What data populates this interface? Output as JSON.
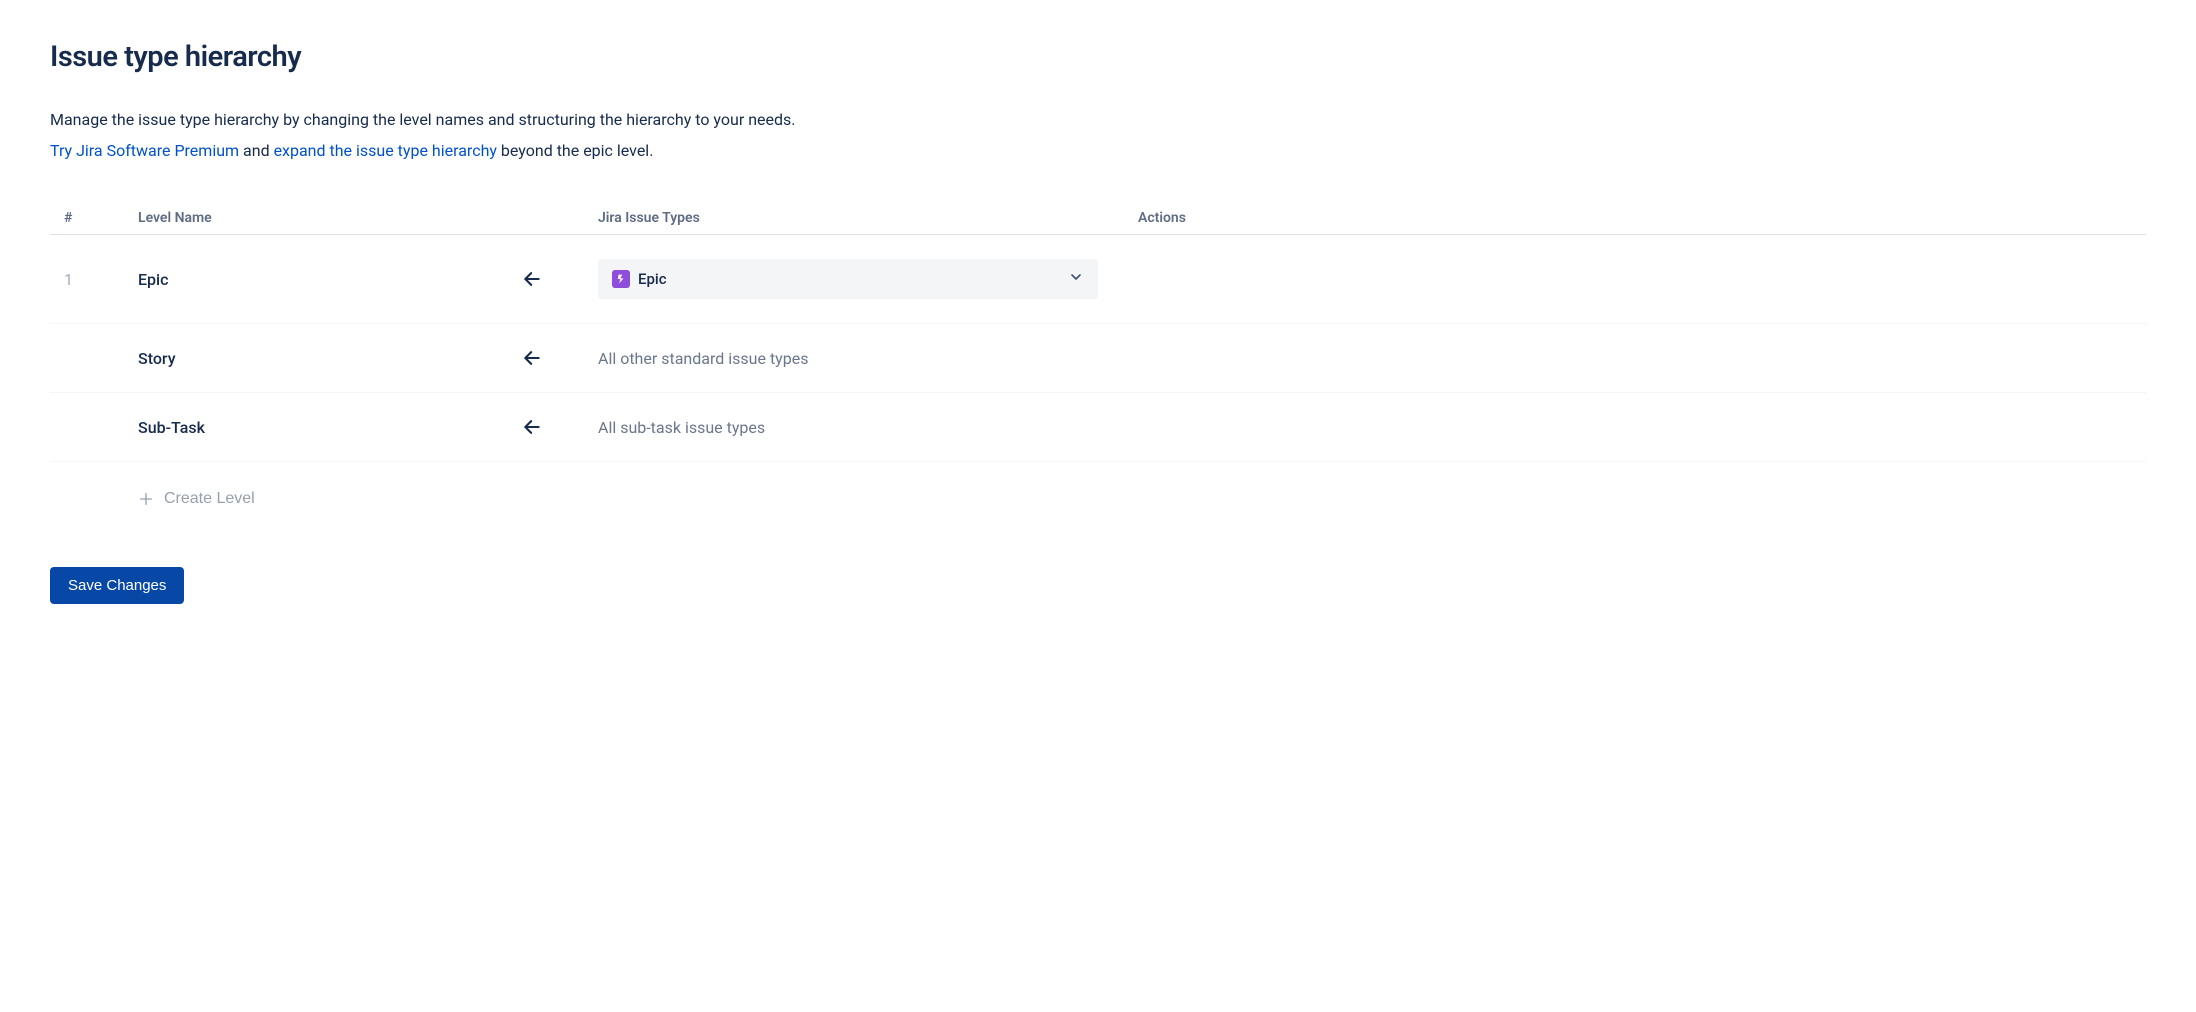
{
  "header": {
    "title": "Issue type hierarchy"
  },
  "description": {
    "text": "Manage the issue type hierarchy by changing the level names and structuring the hierarchy to your needs.",
    "link1": "Try Jira Software Premium",
    "mid": " and ",
    "link2": "expand the issue type hierarchy",
    "after": " beyond the epic level."
  },
  "table": {
    "columns": {
      "num": "#",
      "name": "Level Name",
      "types": "Jira Issue Types",
      "actions": "Actions"
    },
    "rows": [
      {
        "number": "1",
        "levelName": "Epic",
        "typeControl": {
          "kind": "dropdown",
          "label": "Epic"
        }
      },
      {
        "number": "",
        "levelName": "Story",
        "typeText": "All other standard issue types"
      },
      {
        "number": "",
        "levelName": "Sub-Task",
        "typeText": "All sub-task issue types"
      }
    ],
    "createLevelLabel": "Create Level"
  },
  "actions": {
    "saveLabel": "Save Changes"
  }
}
